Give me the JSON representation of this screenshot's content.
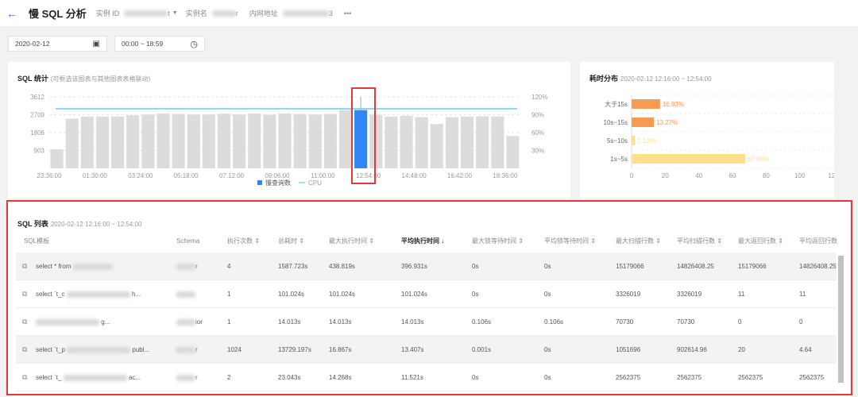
{
  "header": {
    "back_icon": "arrow-left-icon",
    "title": "慢 SQL 分析",
    "instance_id_label": "实例 ID",
    "instance_id_suffix": "t",
    "instance_name_label": "实例名",
    "instance_name_suffix": "r",
    "intranet_label": "内网地址",
    "intranet_suffix": "3",
    "more": "•••"
  },
  "filters": {
    "date": "2020-02-12",
    "date_icon": "calendar-icon",
    "time_range": "00:00 ~ 18:59",
    "time_icon": "clock-icon"
  },
  "sql_stats": {
    "title": "SQL 统计",
    "subtitle": "(可框选该图表与其他图表表格联动)"
  },
  "duration": {
    "title": "耗时分布",
    "subtitle": "2020-02-12 12:16:00 ~ 12:54:00"
  },
  "chart_data": [
    {
      "type": "bar",
      "categories_note": "38-minute buckets starting 23:36:00",
      "x_ticks": [
        "23:36:00",
        "01:30:00",
        "03:24:00",
        "05:18:00",
        "07:12:00",
        "09:06:00",
        "11:00:00",
        "12:54:00",
        "14:48:00",
        "16:42:00",
        "18:36:00"
      ],
      "y_ticks": [
        903,
        1806,
        2709,
        3612
      ],
      "y2_ticks": [
        "30%",
        "60%",
        "90%",
        "120%"
      ],
      "ylim": [
        0,
        3612
      ],
      "y2lim": [
        0,
        1.2
      ],
      "series": [
        {
          "name": "慢查询数",
          "values": [
            968,
            2513,
            2617,
            2617,
            2617,
            2683,
            2722,
            2774,
            2748,
            2722,
            2722,
            2761,
            2722,
            2774,
            2709,
            2774,
            2748,
            2722,
            2748,
            2944,
            2944,
            2709,
            2617,
            2657,
            2591,
            2238,
            2591,
            2617,
            2630,
            2617,
            1636
          ],
          "color": "#dcdcdc",
          "highlight_index": 20,
          "highlight_color": "#2f86f6",
          "highlight_peak": 3612
        },
        {
          "name": "CPU",
          "type": "line",
          "value": "100%",
          "color": "#49c4e6"
        }
      ],
      "legend": "bottom",
      "grid": true
    },
    {
      "type": "bar",
      "orientation": "horizontal",
      "categories": [
        "大于15s",
        "10s~15s",
        "5s~10s",
        "1s~5s"
      ],
      "values": [
        16.93,
        13.27,
        2.12,
        67.68
      ],
      "labels": [
        "16.93%",
        "13.27%",
        "2.12%",
        "67.68%"
      ],
      "colors": [
        "#f99a52",
        "#f99a52",
        "#ffe08a",
        "#ffe08a"
      ],
      "xlim": [
        0,
        120
      ],
      "x_ticks": [
        0,
        20,
        40,
        60,
        80,
        100,
        120
      ],
      "grid": true
    }
  ],
  "sql_list": {
    "title": "SQL 列表",
    "subtitle": "2020-02-12 12:16:00 ~ 12:54:00",
    "columns": [
      "SQL模板",
      "Schema",
      "执行次数 ⇕",
      "总耗时 ⇕",
      "最大执行时间 ⇕",
      "平均执行时间 ↓",
      "最大锁等待时间 ⇕",
      "平均锁等待时间 ⇕",
      "最大扫描行数 ⇕",
      "平均扫描行数 ⇕",
      "最大返回行数 ⇕",
      "平均返回行数"
    ],
    "rows": [
      {
        "sql_prefix": "select * from",
        "sql_suffix": "",
        "schema": "r",
        "cells": [
          "4",
          "1587.723s",
          "438.819s",
          "396.931s",
          "0s",
          "0s",
          "15179066",
          "14826408.25",
          "15179066",
          "14826408.25"
        ]
      },
      {
        "sql_prefix": "select `t_c",
        "sql_suffix": "h...",
        "schema": "",
        "cells": [
          "1",
          "101.024s",
          "101.024s",
          "101.024s",
          "0s",
          "0s",
          "3326019",
          "3326019",
          "11",
          "11"
        ]
      },
      {
        "sql_prefix": "",
        "sql_suffix": "g...",
        "schema": "ior",
        "cells": [
          "1",
          "14.013s",
          "14.013s",
          "14.013s",
          "0.106s",
          "0.106s",
          "70730",
          "70730",
          "0",
          "0"
        ]
      },
      {
        "sql_prefix": "select `t_p",
        "sql_suffix": "publ...",
        "schema": "r",
        "cells": [
          "1024",
          "13729.197s",
          "16.867s",
          "13.407s",
          "0.001s",
          "0s",
          "1051696",
          "902614.96",
          "20",
          "4.64"
        ]
      },
      {
        "sql_prefix": "select `t_",
        "sql_suffix": "ac...",
        "schema": "r",
        "cells": [
          "2",
          "23.043s",
          "14.268s",
          "11.521s",
          "0s",
          "0s",
          "2562375",
          "2562375",
          "2562375",
          "2562375"
        ]
      }
    ]
  }
}
